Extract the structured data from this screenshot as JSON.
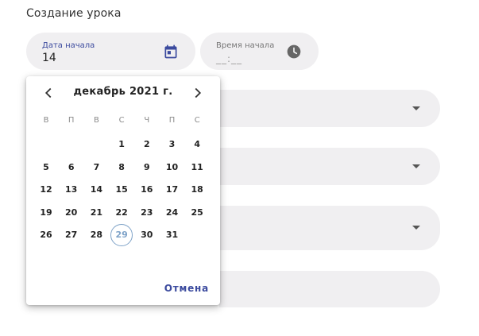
{
  "page": {
    "title": "Создание урока"
  },
  "date_field": {
    "label": "Дата начала",
    "value": "14",
    "icon": "calendar-icon"
  },
  "time_field": {
    "label": "Время начала",
    "value": "__:__",
    "icon": "clock-icon"
  },
  "date_picker": {
    "month_title": "декабрь 2021 г.",
    "weekdays": [
      "В",
      "П",
      "В",
      "С",
      "Ч",
      "П",
      "С"
    ],
    "days": [
      "1",
      "2",
      "3",
      "4",
      "5",
      "6",
      "7",
      "8",
      "9",
      "10",
      "11",
      "12",
      "13",
      "14",
      "15",
      "16",
      "17",
      "18",
      "19",
      "20",
      "21",
      "22",
      "23",
      "24",
      "25",
      "26",
      "27",
      "28",
      "29",
      "30",
      "31"
    ],
    "first_day_column": 3,
    "today": "29",
    "cancel_label": "Отмена",
    "today_color": "#7fa3c8",
    "accent_color": "#3b4a9e"
  }
}
